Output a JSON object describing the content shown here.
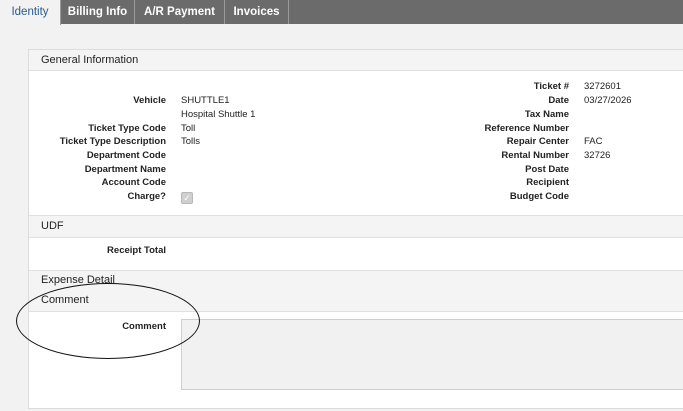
{
  "tabs": [
    "Identity",
    "Billing Info",
    "A/R Payment",
    "Invoices"
  ],
  "sections": {
    "general": "General Information",
    "udf": "UDF",
    "expense": "Expense Detail",
    "comment": "Comment"
  },
  "left_fields": [
    {
      "label": "Vehicle",
      "value": "SHUTTLE1"
    },
    {
      "label": "",
      "value": "Hospital Shuttle 1"
    },
    {
      "label": "Ticket Type Code",
      "value": "Toll"
    },
    {
      "label": "Ticket Type Description",
      "value": "Tolls"
    },
    {
      "label": "Department Code",
      "value": ""
    },
    {
      "label": "Department Name",
      "value": ""
    },
    {
      "label": "Account Code",
      "value": ""
    },
    {
      "label": "Charge?",
      "value": ""
    }
  ],
  "right_fields": [
    {
      "label": "Ticket #",
      "value": "3272601"
    },
    {
      "label": "Date",
      "value": "03/27/2026"
    },
    {
      "label": "Tax Name",
      "value": ""
    },
    {
      "label": "Reference Number",
      "value": ""
    },
    {
      "label": "Repair Center",
      "value": "FAC"
    },
    {
      "label": "Rental Number",
      "value": "32726"
    },
    {
      "label": "Post Date",
      "value": ""
    },
    {
      "label": "Recipient",
      "value": ""
    },
    {
      "label": "Budget Code",
      "value": ""
    }
  ],
  "udf": {
    "receipt_total_label": "Receipt Total",
    "receipt_total_value": ""
  },
  "comment": {
    "label": "Comment",
    "value": ""
  },
  "charge_checked": true,
  "colors": {
    "tabbar": "#6b6b6b",
    "active_tab_text": "#2a5a8a"
  }
}
